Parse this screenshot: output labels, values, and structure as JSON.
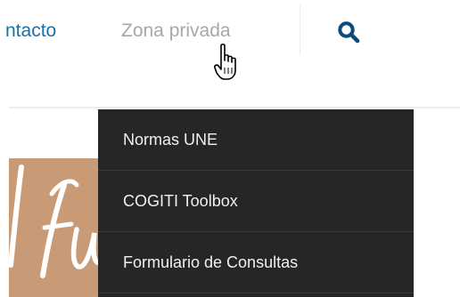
{
  "header": {
    "nav": {
      "contact_label": "ntacto",
      "private_zone_label": "Zona privada"
    },
    "search_icon": "search-icon"
  },
  "dropdown": {
    "items": [
      {
        "label": "Normas UNE"
      },
      {
        "label": "COGITI Toolbox"
      },
      {
        "label": "Formulario de Consultas"
      }
    ]
  },
  "colors": {
    "link": "#1f6ea3",
    "link_hover": "#a7a7a7",
    "search_icon": "#0d4a7c",
    "dropdown_bg": "#262626",
    "dropdown_text": "#f0f0f0",
    "hero_bg": "#c99a76"
  },
  "cursor_icon": "hand-pointer-icon"
}
